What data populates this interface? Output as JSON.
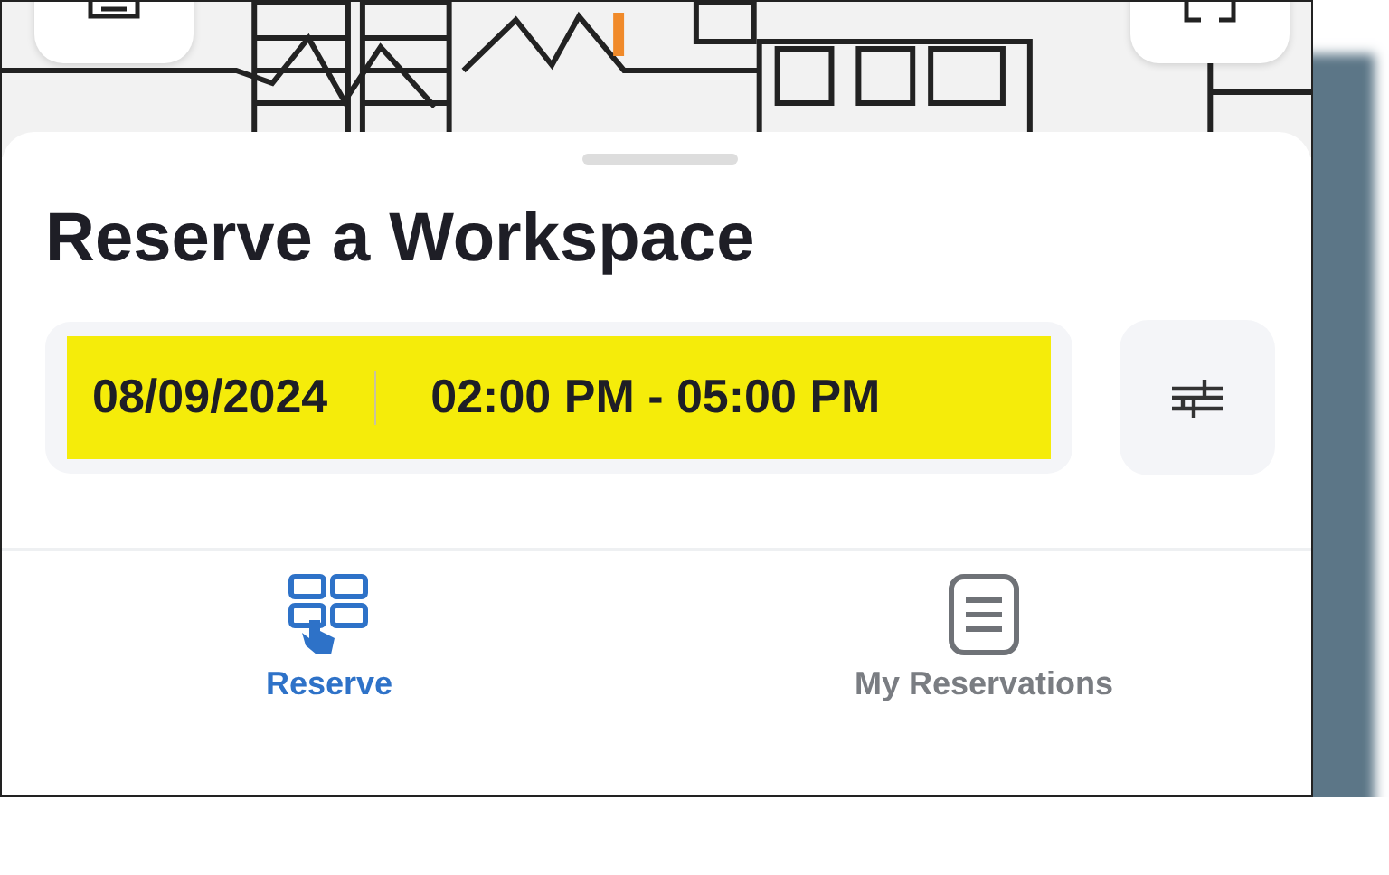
{
  "sheet": {
    "title": "Reserve a Workspace",
    "date": "08/09/2024",
    "time_range": "02:00 PM - 05:00 PM",
    "highlighted": true
  },
  "tabs": [
    {
      "label": "Reserve",
      "selected": true,
      "kind": "grid"
    },
    {
      "label": "My Reservations",
      "selected": false,
      "kind": "list"
    }
  ]
}
